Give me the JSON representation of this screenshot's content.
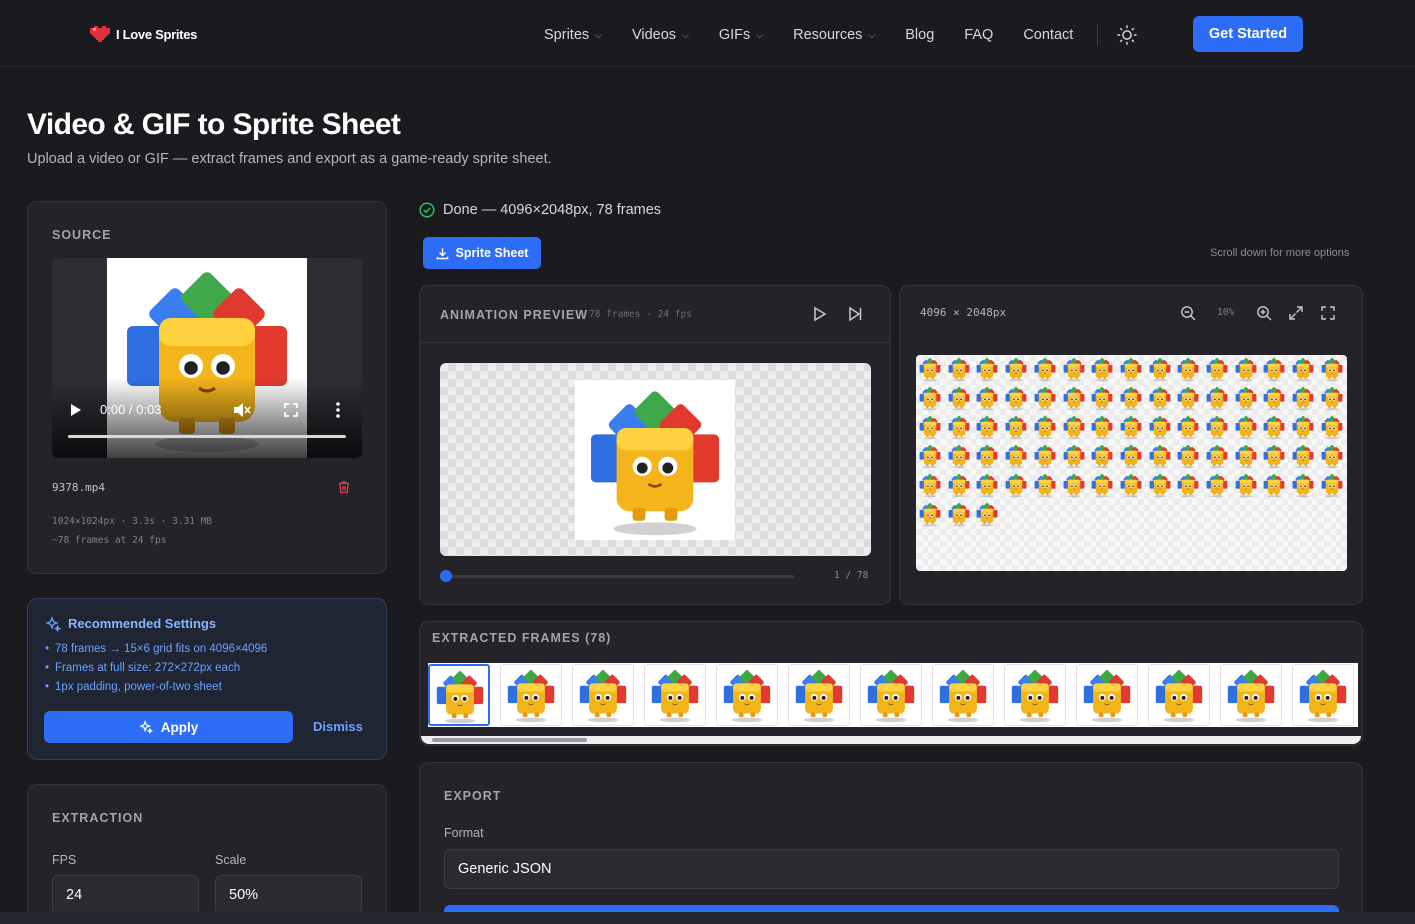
{
  "header": {
    "logo_text": "I Love Sprites",
    "nav": [
      {
        "label": "Sprites",
        "dropdown": true
      },
      {
        "label": "Videos",
        "dropdown": true
      },
      {
        "label": "GIFs",
        "dropdown": true
      },
      {
        "label": "Resources",
        "dropdown": true
      },
      {
        "label": "Blog",
        "dropdown": false
      },
      {
        "label": "FAQ",
        "dropdown": false
      },
      {
        "label": "Contact",
        "dropdown": false
      }
    ],
    "theme_icon": "sun-icon",
    "cta_label": "Get Started"
  },
  "hero": {
    "title": "Video & GIF to Sprite Sheet",
    "subtitle": "Upload a video or GIF — extract frames and export as a game-ready sprite sheet."
  },
  "source": {
    "label": "SOURCE",
    "time": "0:00 / 0:03",
    "filename": "9378.mp4",
    "meta_line1": "1024×1024px · 3.3s · 3.31 MB",
    "meta_line2": "~78 frames at 24 fps"
  },
  "recommended": {
    "title": "Recommended Settings",
    "items": [
      "78 frames → 15×6 grid fits on 4096×4096",
      "Frames at full size: 272×272px each",
      "1px padding, power-of-two sheet"
    ],
    "apply_label": "Apply",
    "dismiss_label": "Dismiss"
  },
  "extraction": {
    "label": "EXTRACTION",
    "fps_label": "FPS",
    "fps_value": "24",
    "scale_label": "Scale",
    "scale_value": "50%"
  },
  "status": {
    "text": "Done — 4096×2048px, 78 frames",
    "sheet_button": "Sprite Sheet",
    "scroll_hint": "Scroll down for more options"
  },
  "animation_preview": {
    "label": "ANIMATION PREVIEW",
    "meta": "78 frames · 24 fps",
    "counter": "1 / 78",
    "progress": 0.0
  },
  "sheet_preview": {
    "size": "4096 × 2048px",
    "zoom": "10%",
    "total_frames": 78,
    "columns": 15
  },
  "extracted_frames": {
    "label": "EXTRACTED FRAMES (78)",
    "visible_count": 13,
    "selected_index": 0
  },
  "export": {
    "label": "EXPORT",
    "format_label": "Format",
    "format_value": "Generic JSON"
  },
  "colors": {
    "accent": "#2d6df6",
    "background": "#1b1b1f",
    "card": "#232329",
    "success": "#22c55e"
  }
}
